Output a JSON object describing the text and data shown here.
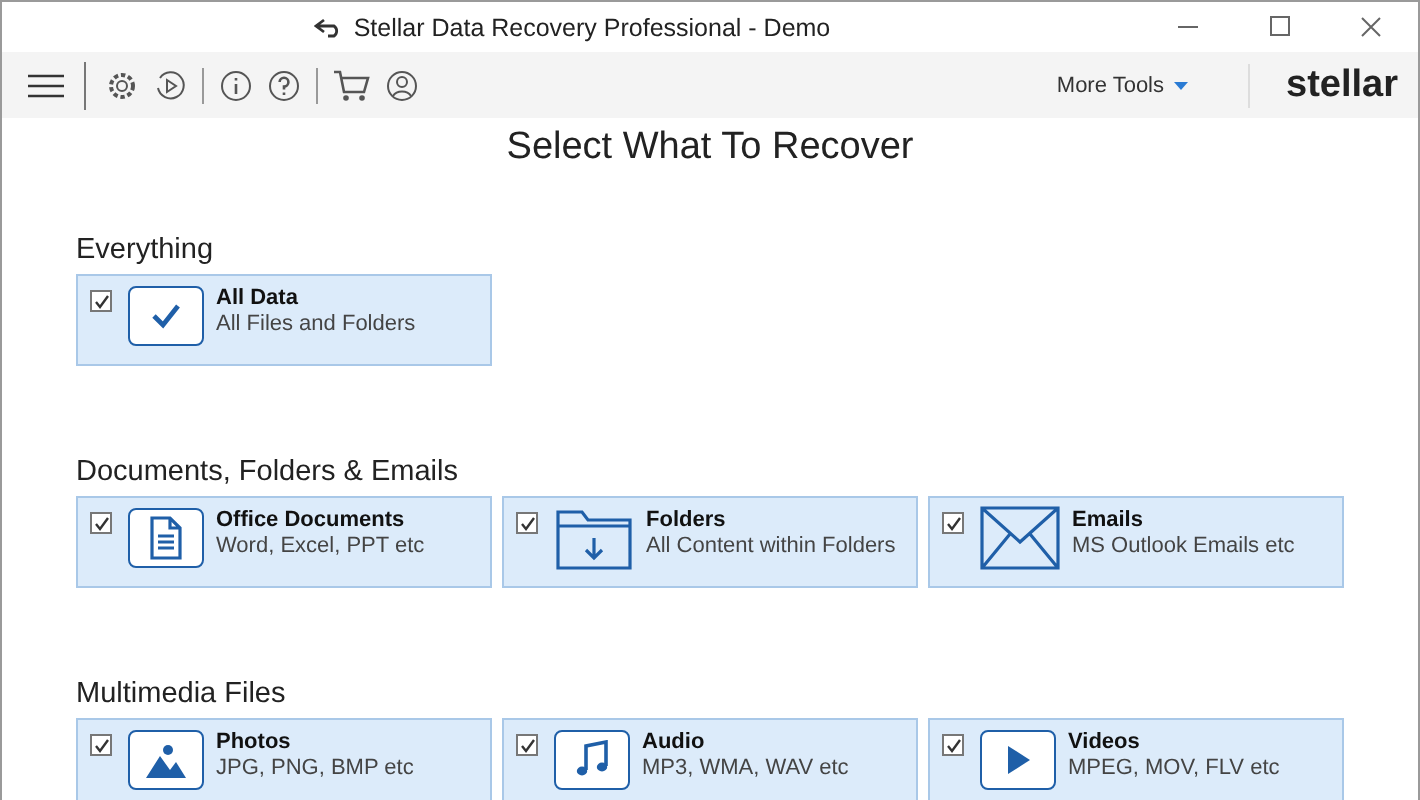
{
  "window": {
    "title": "Stellar Data Recovery Professional - Demo"
  },
  "toolbar": {
    "more_tools": "More Tools",
    "logo": "stellar"
  },
  "heading": "Select What To Recover",
  "sections": [
    {
      "title": "Everything",
      "items": [
        {
          "kind": "check",
          "name": "All Data",
          "description": "All Files and Folders",
          "checked": true
        }
      ]
    },
    {
      "title": "Documents, Folders & Emails",
      "items": [
        {
          "kind": "document",
          "name": "Office Documents",
          "description": "Word, Excel, PPT etc",
          "checked": true
        },
        {
          "kind": "folder",
          "name": "Folders",
          "description": "All Content within Folders",
          "checked": true
        },
        {
          "kind": "mail",
          "name": "Emails",
          "description": "MS Outlook Emails etc",
          "checked": true
        }
      ]
    },
    {
      "title": "Multimedia Files",
      "items": [
        {
          "kind": "photo",
          "name": "Photos",
          "description": "JPG, PNG, BMP etc",
          "checked": true
        },
        {
          "kind": "audio",
          "name": "Audio",
          "description": "MP3, WMA, WAV etc",
          "checked": true
        },
        {
          "kind": "video",
          "name": "Videos",
          "description": "MPEG, MOV, FLV etc",
          "checked": true
        }
      ]
    }
  ]
}
